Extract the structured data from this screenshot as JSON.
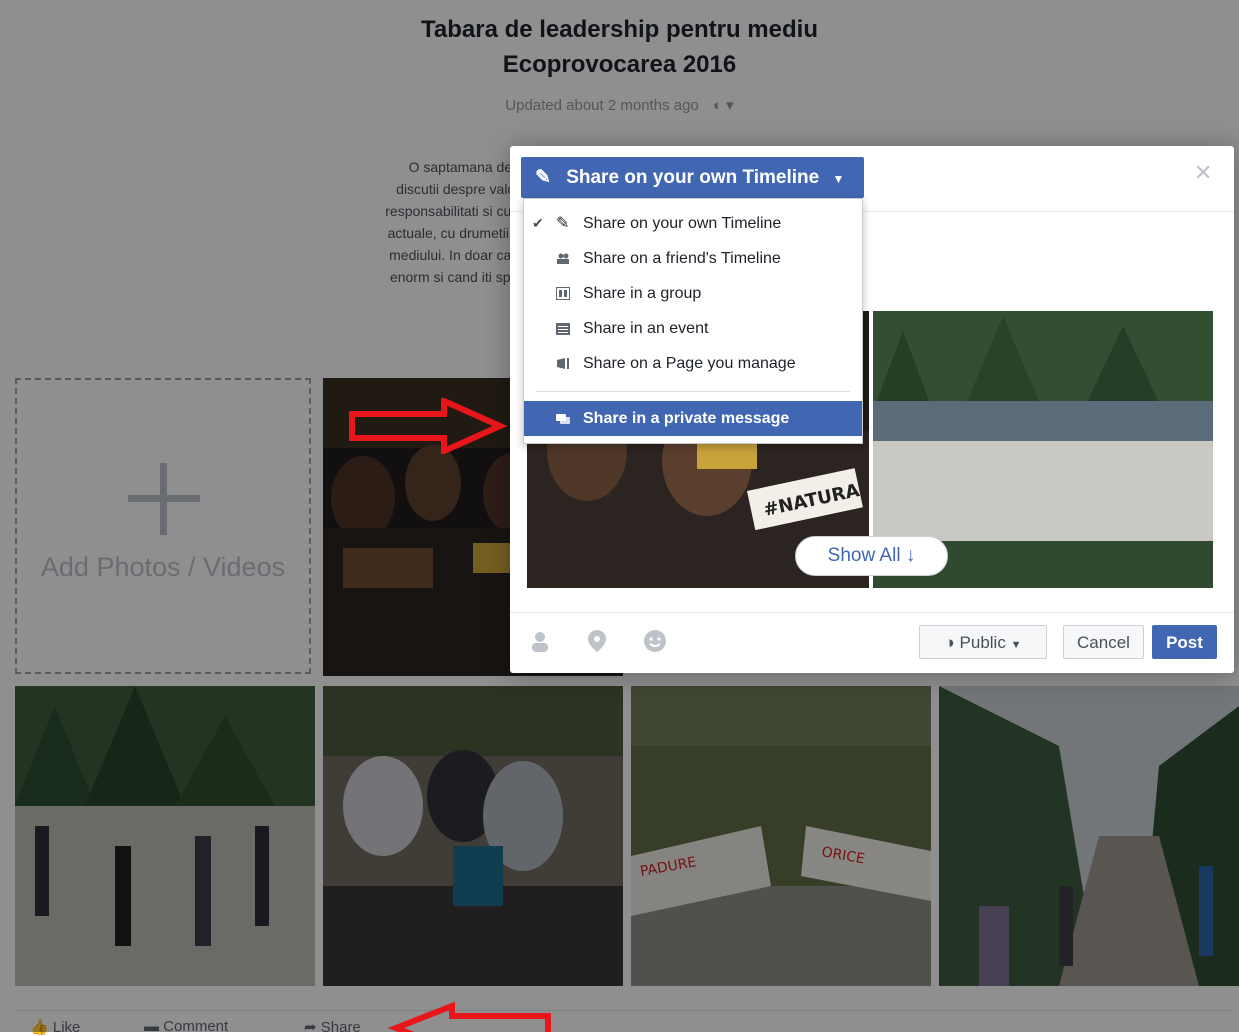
{
  "album": {
    "title_line1": "Tabara de leadership pentru mediu",
    "title_line2": "Ecoprovocarea 2016",
    "updated": "Updated about 2 months ago",
    "description_lines": [
      "O saptamana de v",
      "discutii despre valori",
      "responsabilitati si cum",
      "actuale, cu drumetii si",
      "mediului. In doar cate",
      "enorm si cand iti spur"
    ]
  },
  "add_photos": {
    "label": "Add Photos / Videos"
  },
  "post_actions": {
    "like": "Like",
    "comment": "Comment",
    "share": "Share"
  },
  "share_dialog": {
    "selector_label": "Share on your own Timeline",
    "menu_items": [
      "Share on your own Timeline",
      "Share on a friend's Timeline",
      "Share in a group",
      "Share in an event",
      "Share on a Page you manage",
      "Share in a private message"
    ],
    "show_all": "Show All ↓",
    "privacy": "Public",
    "cancel": "Cancel",
    "post": "Post"
  },
  "colors": {
    "brand": "#4267b2",
    "annotation_arrow": "#e8161b"
  },
  "icons": [
    "edit-icon",
    "chevron-down-icon",
    "close-icon",
    "friends-icon",
    "group-icon",
    "event-icon",
    "page-icon",
    "message-icon",
    "tag-friends-icon",
    "location-icon",
    "feeling-icon",
    "globe-icon",
    "like-icon",
    "comment-icon",
    "share-icon"
  ]
}
